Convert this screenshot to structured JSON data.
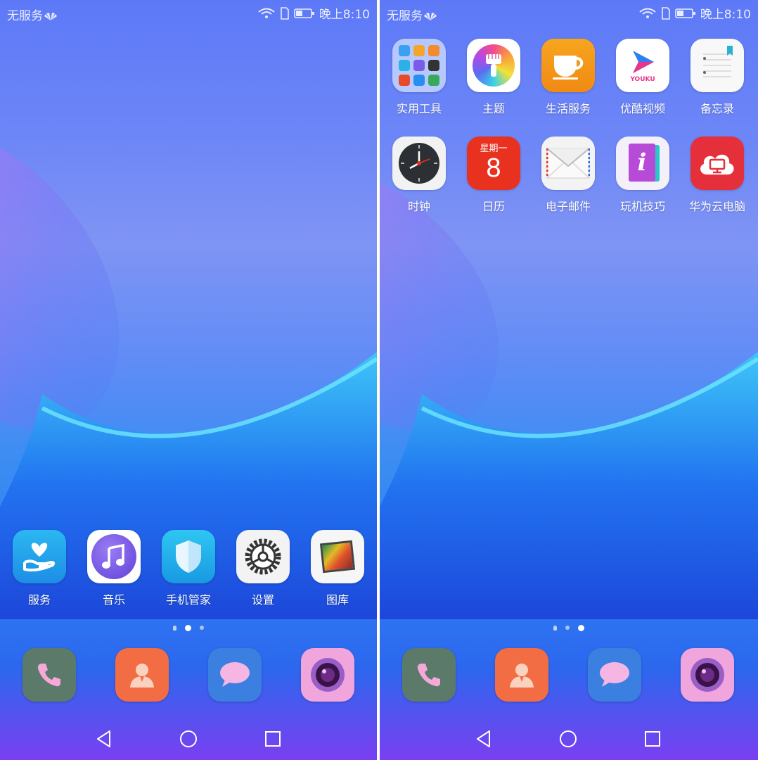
{
  "status_bar": {
    "carrier": "无服务",
    "time": "晚上8:10"
  },
  "left_screen": {
    "apps": [
      {
        "label": "服务",
        "icon": "heart-hand-icon"
      },
      {
        "label": "音乐",
        "icon": "music-note-icon"
      },
      {
        "label": "手机管家",
        "icon": "shield-icon"
      },
      {
        "label": "设置",
        "icon": "gear-icon"
      },
      {
        "label": "图库",
        "icon": "gallery-icon"
      }
    ],
    "page_indicator": {
      "pages": 3,
      "active": 2
    }
  },
  "right_screen": {
    "apps": [
      {
        "label": "实用工具",
        "icon": "folder-icon"
      },
      {
        "label": "主题",
        "icon": "paintbrush-icon"
      },
      {
        "label": "生活服务",
        "icon": "coffee-cup-icon"
      },
      {
        "label": "优酷视频",
        "icon": "youku-play-icon",
        "icon_text": "YOUKU"
      },
      {
        "label": "备忘录",
        "icon": "notepad-icon"
      },
      {
        "label": "时钟",
        "icon": "clock-icon"
      },
      {
        "label": "日历",
        "icon": "calendar-icon",
        "weekday": "星期一",
        "day": "8"
      },
      {
        "label": "电子邮件",
        "icon": "envelope-icon"
      },
      {
        "label": "玩机技巧",
        "icon": "info-book-icon",
        "icon_text": "i"
      },
      {
        "label": "华为云电脑",
        "icon": "cloud-monitor-icon"
      }
    ],
    "page_indicator": {
      "pages": 3,
      "active": 3
    }
  },
  "dock": [
    {
      "icon": "phone-icon"
    },
    {
      "icon": "contacts-icon"
    },
    {
      "icon": "messages-icon"
    },
    {
      "icon": "camera-icon"
    }
  ],
  "nav_bar": [
    {
      "icon": "back-icon"
    },
    {
      "icon": "home-icon"
    },
    {
      "icon": "recents-icon"
    }
  ],
  "colors": {
    "phone": "#5b7a6a",
    "contacts": "#f26d43",
    "messages": "#3b7fe0",
    "camera": "#f0a6dd",
    "calendar_red": "#e8321f",
    "cloud_red": "#e52f3a"
  }
}
